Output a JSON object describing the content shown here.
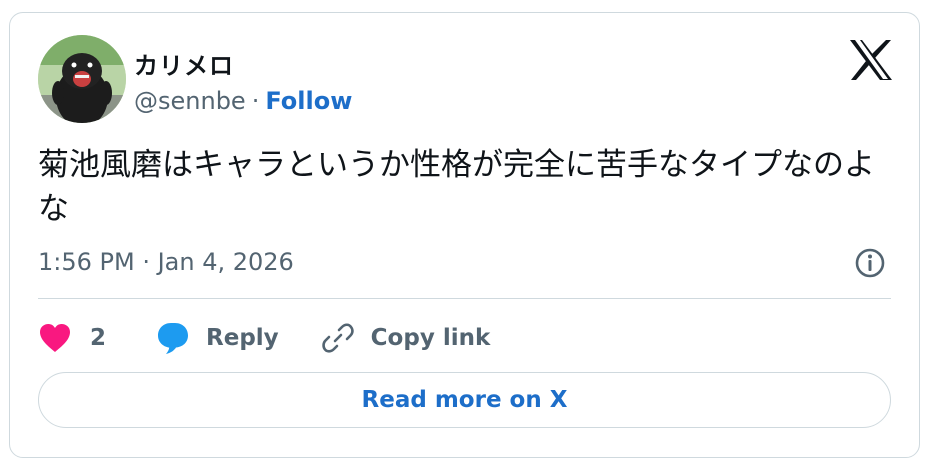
{
  "author": {
    "name": "カリメロ",
    "handle": "@sennbe",
    "separator": "·",
    "follow_label": "Follow"
  },
  "tweet": {
    "text": "菊池風磨はキャラというか性格が完全に苦手なタイプなのよな",
    "timestamp": "1:56 PM · Jan 4, 2026"
  },
  "actions": {
    "like_count": "2",
    "reply_label": "Reply",
    "copy_link_label": "Copy link"
  },
  "read_more_label": "Read more on X",
  "icons": {
    "brand": "x-logo-icon",
    "info": "info-icon",
    "like": "heart-icon",
    "reply": "speech-bubble-icon",
    "copy": "link-icon"
  },
  "colors": {
    "heart": "#f91880",
    "reply": "#1d9bf0",
    "follow": "#1d6ec9",
    "muted": "#536471",
    "border": "#cfd9de"
  }
}
